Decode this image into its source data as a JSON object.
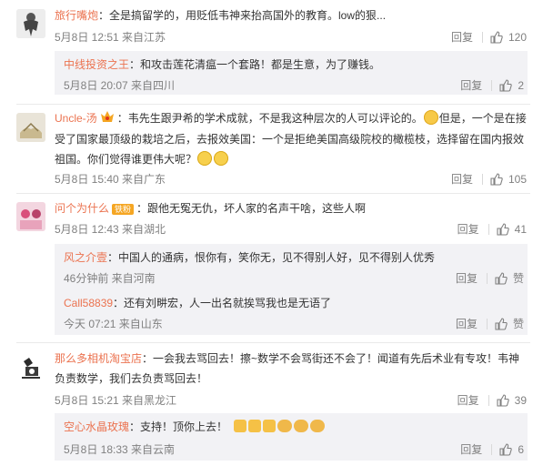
{
  "comments": [
    {
      "user": "旅行嘴炮",
      "text": "：全是搞留学的，用贬低韦神来抬高国外的教育。low的狠...",
      "time": "5月8日 12:51 来自江苏",
      "reply": "回复",
      "likes": "120",
      "sub": {
        "user": "中线投资之王",
        "text": "：和攻击莲花清瘟一个套路！都是生意，为了赚钱。",
        "time": "5月8日 20:07 来自四川",
        "reply": "回复",
        "likes": "2"
      }
    },
    {
      "user": "Uncle-汤",
      "text1": "：韦先生跟尹希的学术成就，不是我这种层次的人可以评论的。",
      "text2": "但是，一个是在接受了国家最顶级的栽培之后，去报效美国：一个是拒绝美国高级院校的橄榄枝，选择留在国内报效祖国。你们觉得谁更伟大呢？",
      "time": "5月8日 15:40 来自广东",
      "reply": "回复",
      "likes": "105"
    },
    {
      "user": "问个为什么",
      "badge": "铁粉",
      "text": "：跟他无冤无仇，坏人家的名声干啥，这些人啊",
      "time": "5月8日 12:43 来自湖北",
      "reply": "回复",
      "likes": "41",
      "subs": [
        {
          "user": "风之介壹",
          "text": "：中国人的通病，恨你有，笑你无，见不得别人好，见不得别人优秀",
          "time": "46分钟前 来自河南",
          "reply": "回复",
          "likes": "赞"
        },
        {
          "user": "Call58839",
          "text": "：还有刘畊宏，人一出名就挨骂我也是无语了",
          "time": "今天 07:21 来自山东",
          "reply": "回复",
          "likes": "赞"
        }
      ]
    },
    {
      "user": "那么多相机淘宝店",
      "text": "：一会我去骂回去！擦~数学不会骂街还不会了！闻道有先后术业有专攻！韦神负责数学，我们去负责骂回去！",
      "time": "5月8日 15:21 来自黑龙江",
      "reply": "回复",
      "likes": "39",
      "sub": {
        "user": "空心水晶玫瑰",
        "text": "：支持！顶你上去！",
        "time": "5月8日 18:33 来自云南",
        "reply": "回复",
        "likes": "6"
      }
    }
  ],
  "colors": {
    "name": "#eb7350",
    "meta": "#808080",
    "sub_bg": "#f2f2f5"
  }
}
